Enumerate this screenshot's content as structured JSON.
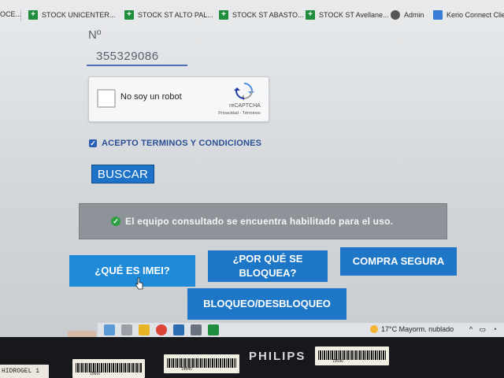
{
  "bookmarks": [
    {
      "label": "OCE...",
      "icon": "bookmark-icon"
    },
    {
      "label": "STOCK UNICENTER...",
      "icon": "spreadsheet-icon"
    },
    {
      "label": "STOCK ST ALTO PAL...",
      "icon": "spreadsheet-icon"
    },
    {
      "label": "STOCK ST ABASTO...",
      "icon": "spreadsheet-icon"
    },
    {
      "label": "STOCK ST Avellane...",
      "icon": "spreadsheet-icon"
    },
    {
      "label": "Admin",
      "icon": "github-icon"
    },
    {
      "label": "Kerio Connect Clien",
      "icon": "kerio-icon"
    }
  ],
  "form": {
    "number_label": "Nº",
    "imei_value": "355329086"
  },
  "captcha": {
    "label": "No soy un robot",
    "brand": "reCAPTCHA",
    "links": "Privacidad - Términos"
  },
  "terms": {
    "label": "ACEPTO TERMINOS Y CONDICIONES",
    "checked": true
  },
  "search_button": "BUSCAR",
  "alert": {
    "message": "El equipo consultado se encuentra habilitado para el uso.",
    "status_color": "#2ea043"
  },
  "info_buttons": {
    "imei": "¿QUÉ ES IMEI?",
    "why_blocked": "¿POR QUÉ SE BLOQUEA?",
    "safe_purchase": "COMPRA SEGURA",
    "block_unblock": "BLOQUEO/DESBLOQUEO"
  },
  "taskbar": {
    "weather": "17°C  Mayorm. nublado"
  },
  "monitor": {
    "brand": "PHILIPS",
    "hand_label": "HIDROGEL 1",
    "sticker_numbers": [
      "15697",
      "14845",
      "15696"
    ]
  },
  "colors": {
    "accent": "#1e76c6",
    "link": "#2b4f94"
  }
}
